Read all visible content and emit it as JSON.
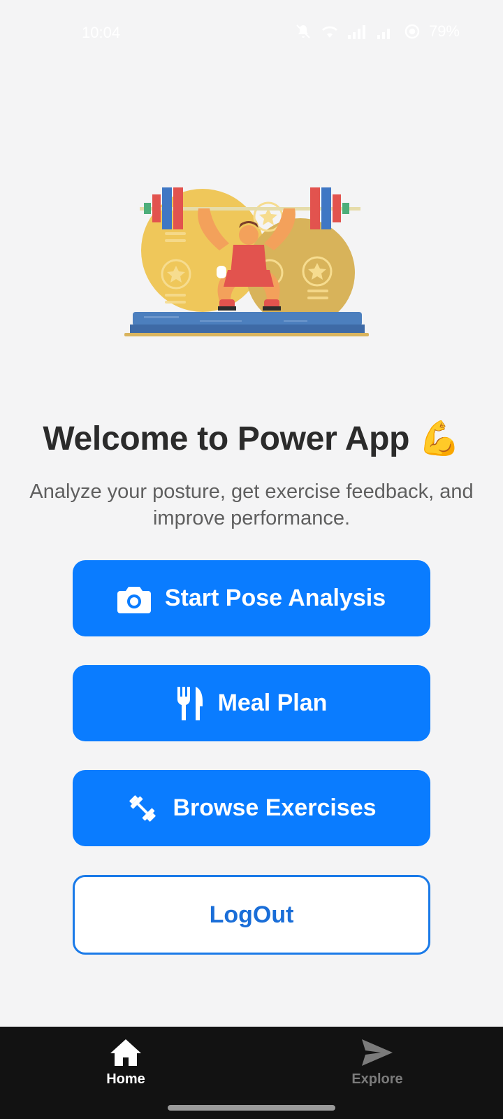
{
  "status_bar": {
    "time": "10:04",
    "battery": "79%"
  },
  "welcome": {
    "title": "Welcome to Power App 💪",
    "subtitle": "Analyze your posture, get exercise feedback, and improve performance."
  },
  "buttons": {
    "pose_analysis": {
      "label": "Start Pose Analysis",
      "icon": "camera-icon"
    },
    "meal_plan": {
      "label": "Meal Plan",
      "icon": "fork-knife-icon"
    },
    "browse_exercises": {
      "label": "Browse Exercises",
      "icon": "dumbbell-icon"
    },
    "logout": {
      "label": "LogOut"
    }
  },
  "bottom_nav": {
    "items": [
      {
        "label": "Home",
        "icon": "home-icon",
        "active": true
      },
      {
        "label": "Explore",
        "icon": "paper-plane-icon",
        "active": false
      }
    ]
  },
  "colors": {
    "primary": "#0a7cff",
    "background": "#f4f4f5",
    "nav_background": "#121212",
    "title": "#2b2b2b",
    "subtitle": "#5f5f5f"
  }
}
